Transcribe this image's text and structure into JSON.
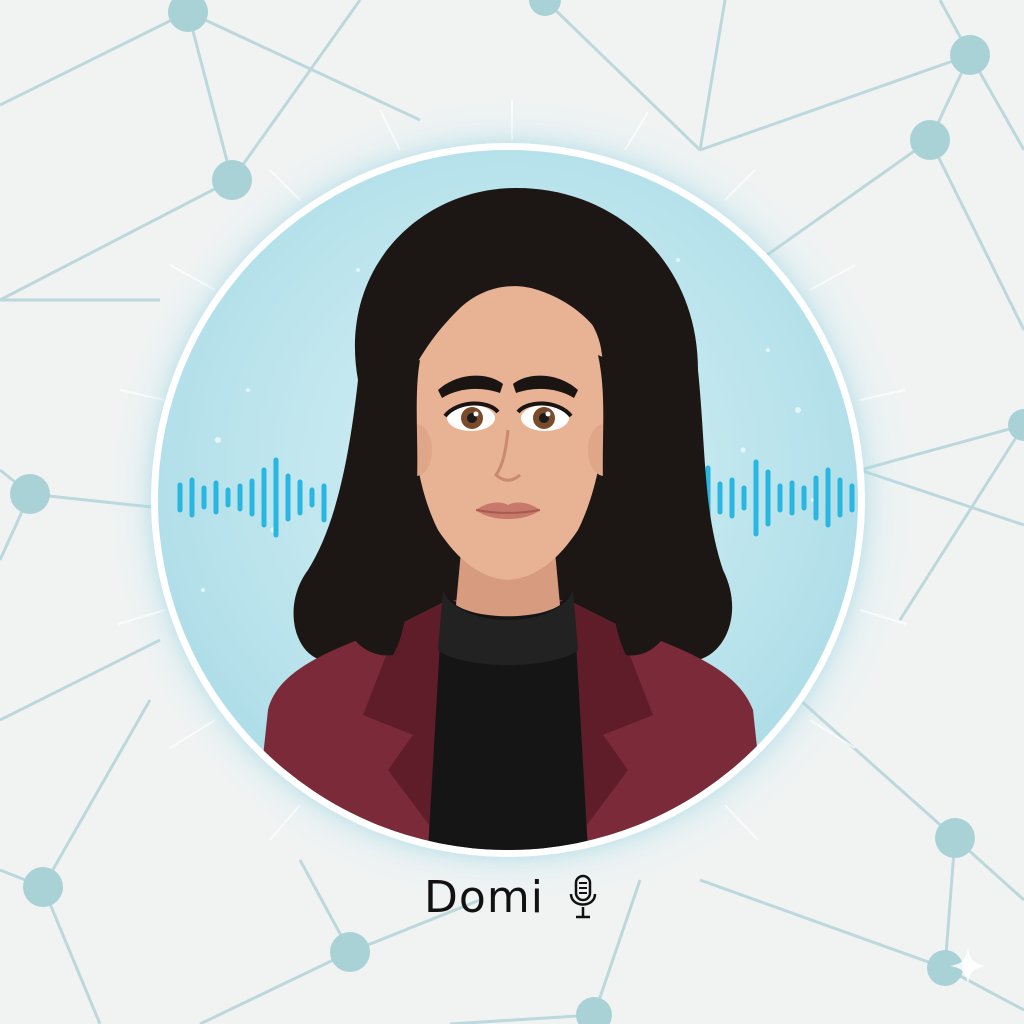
{
  "profile": {
    "name": "Domi"
  },
  "icons": {
    "mic": "microphone-icon",
    "sparkle": "sparkle-icon"
  },
  "colors": {
    "background": "#f1f3f3",
    "glow": "#9ed4e1",
    "network_node": "#a9d2d6",
    "waveform": "#29b6e0",
    "jacket": "#7a2a38",
    "turtleneck": "#151515",
    "hair": "#1c1715",
    "skin": "#e8b294"
  }
}
